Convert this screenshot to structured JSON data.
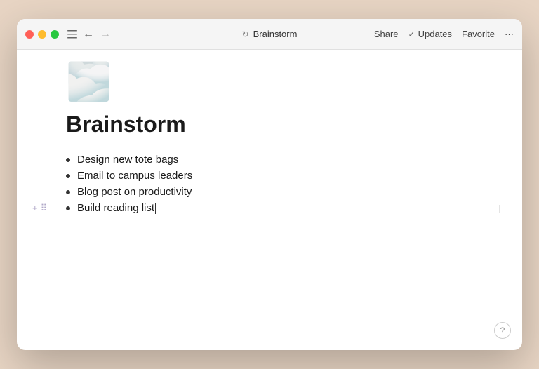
{
  "window": {
    "title": "Brainstorm"
  },
  "titlebar": {
    "title": "Brainstorm",
    "actions": {
      "share": "Share",
      "updates": "Updates",
      "favorite": "Favorite",
      "more": "···"
    }
  },
  "page": {
    "icon": "🌫️",
    "title": "Brainstorm",
    "list_items": [
      {
        "id": 1,
        "text": "Design new tote bags",
        "active": false
      },
      {
        "id": 2,
        "text": "Email to campus leaders",
        "active": false
      },
      {
        "id": 3,
        "text": "Blog post on productivity",
        "active": false
      },
      {
        "id": 4,
        "text": "Build reading list",
        "active": true
      }
    ]
  },
  "help": {
    "label": "?"
  }
}
